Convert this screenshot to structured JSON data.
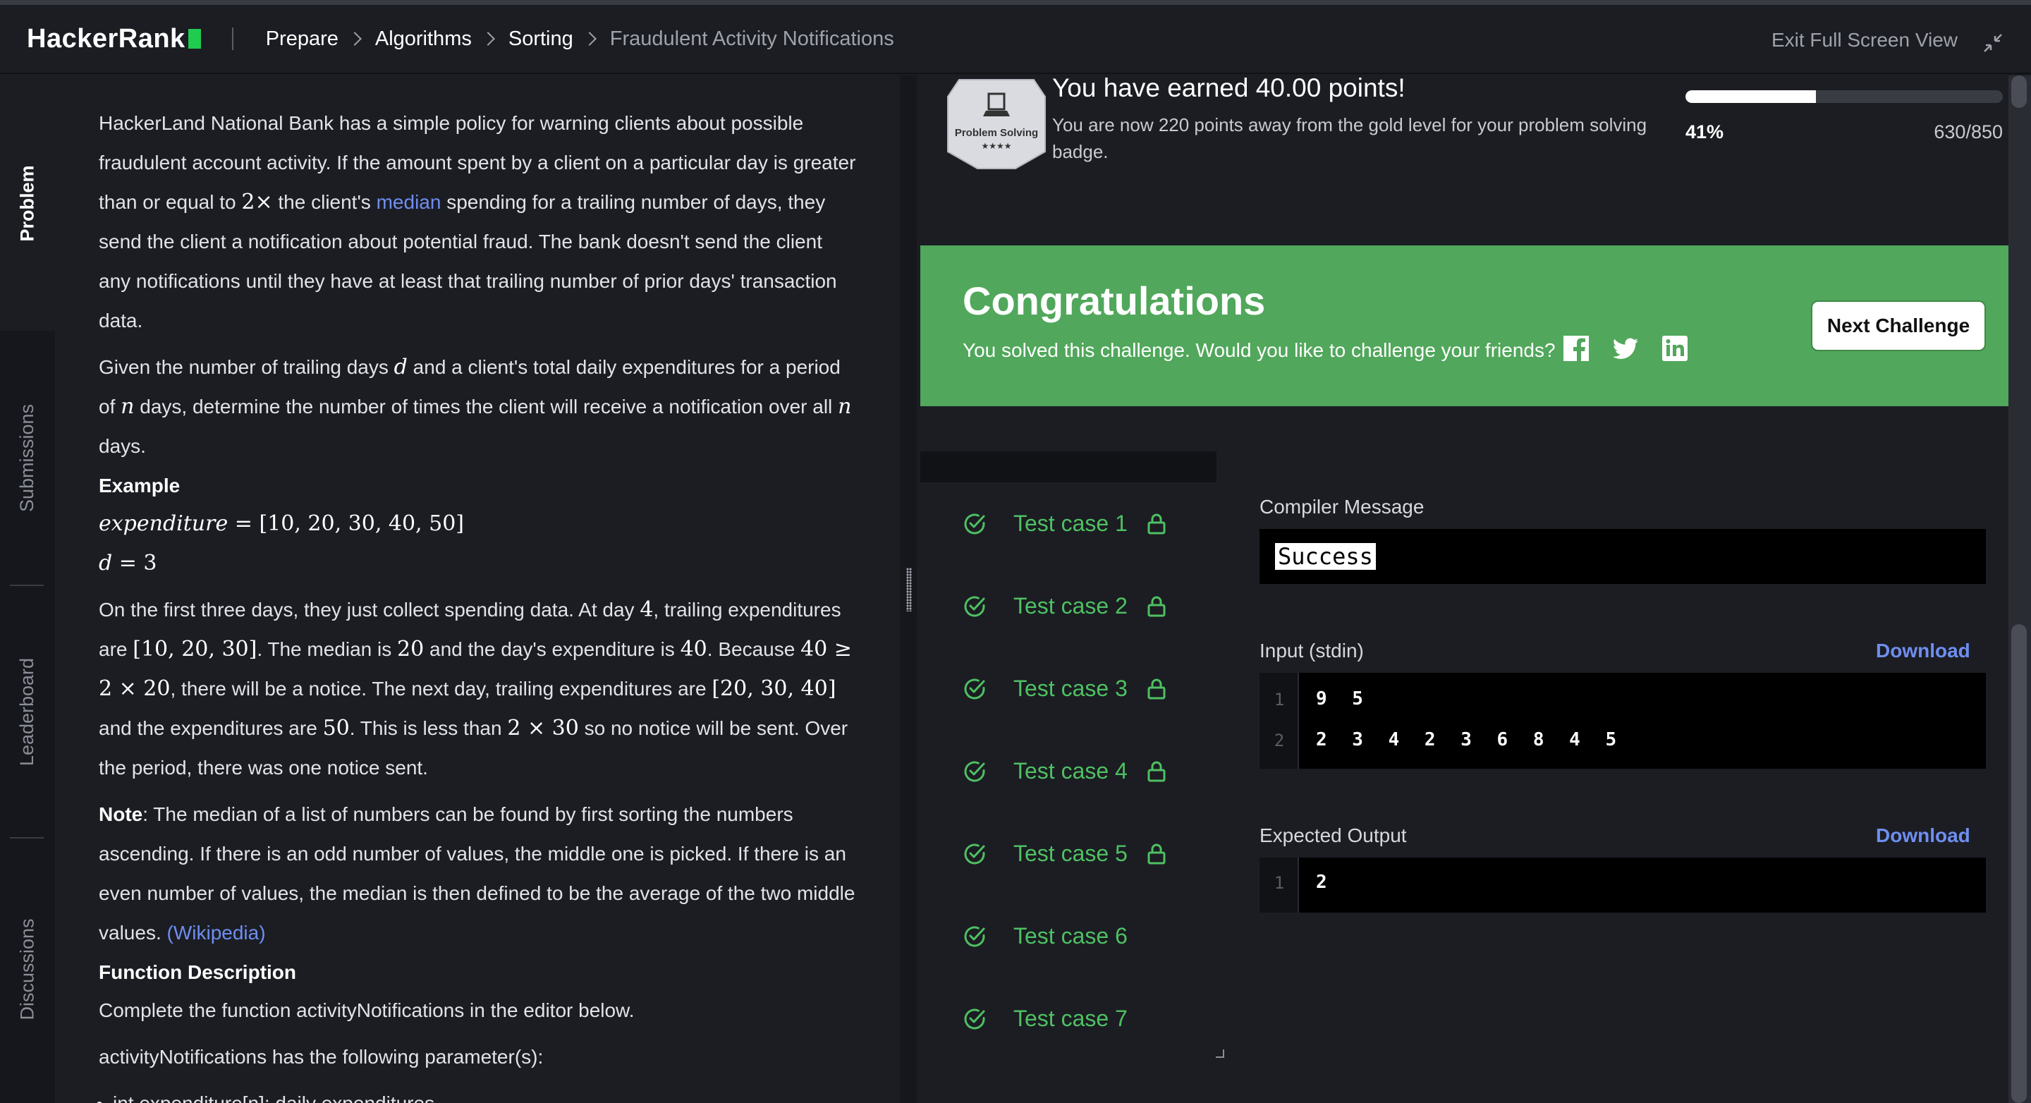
{
  "header": {
    "logo": "HackerRank",
    "breadcrumbs": [
      "Prepare",
      "Algorithms",
      "Sorting",
      "Fraudulent Activity Notifications"
    ],
    "exit_label": "Exit Full Screen View"
  },
  "side_tabs": [
    "Problem",
    "Submissions",
    "Leaderboard",
    "Discussions"
  ],
  "problem": {
    "p1_a": "HackerLand National Bank has a simple policy for warning clients about possible fraudulent account activity. If the amount spent by a client on a particular day is greater than or equal to ",
    "p1_math": "2×",
    "p1_b": " the client's ",
    "p1_link": "median",
    "p1_c": " spending for a trailing number of days, they send the client a notification about potential fraud. The bank doesn't send the client any notifications until they have at least that trailing number of prior days' transaction data.",
    "p2_a": "Given the number of trailing days ",
    "p2_d": "d",
    "p2_b": " and a client's total daily expenditures for a period of ",
    "p2_n1": "n",
    "p2_c": " days, determine the number of times the client will receive a notification over all ",
    "p2_n2": "n",
    "p2_d2": " days.",
    "example_heading": "Example",
    "ex_line1_var": "expenditure",
    "ex_line1_val": " = [10, 20, 30, 40, 50]",
    "ex_line2_var": "d",
    "ex_line2_val": " = 3",
    "p3_a": "On the first three days, they just collect spending data. At day ",
    "p3_m1": "4",
    "p3_b": ", trailing expenditures are ",
    "p3_m2": "[10, 20, 30]",
    "p3_c": ". The median is ",
    "p3_m3": "20",
    "p3_d": " and the day's expenditure is ",
    "p3_m4": "40",
    "p3_e": ". Because ",
    "p3_m5": "40 ≥ 2 × 20",
    "p3_f": ", there will be a notice. The next day, trailing expenditures are ",
    "p3_m6": "[20, 30, 40]",
    "p3_g": " and the expenditures are ",
    "p3_m7": "50",
    "p3_h": ". This is less than ",
    "p3_m8": "2 × 30",
    "p3_i": " so no notice will be sent. Over the period, there was one notice sent.",
    "note_label": "Note",
    "note_text": ": The median of a list of numbers can be found by first sorting the numbers ascending. If there is an odd number of values, the middle one is picked. If there is an even number of values, the median is then defined to be the average of the two middle values. ",
    "note_link": "(Wikipedia)",
    "func_heading": "Function Description",
    "func_p1": "Complete the function activityNotifications in the editor below.",
    "func_p2": "activityNotifications has the following parameter(s):",
    "param1": "int expenditure[n]: daily expenditures"
  },
  "result": {
    "badge_label": "Problem Solving",
    "badge_stars": "★★★★",
    "earned": "You have earned 40.00 points!",
    "away": "You are now 220 points away from the gold level for your problem solving badge.",
    "progress_fraction": 0.41,
    "progress_pct": "41%",
    "progress_points": "630/850",
    "congrats_title": "Congratulations",
    "congrats_sub": "You solved this challenge. Would you like to challenge your friends?",
    "next_button": "Next Challenge"
  },
  "test_cases": [
    {
      "label": "Test case 1",
      "locked": true
    },
    {
      "label": "Test case 2",
      "locked": true
    },
    {
      "label": "Test case 3",
      "locked": true
    },
    {
      "label": "Test case 4",
      "locked": true
    },
    {
      "label": "Test case 5",
      "locked": true
    },
    {
      "label": "Test case 6",
      "locked": false
    },
    {
      "label": "Test case 7",
      "locked": false
    }
  ],
  "output_panel": {
    "compiler_label": "Compiler Message",
    "compiler_message": "Success",
    "input_label": "Input (stdin)",
    "download_label": "Download",
    "input_lines": [
      "9 5",
      "2 3 4 2 3 6 8 4 5"
    ],
    "input_line_numbers": [
      "1",
      "2"
    ],
    "expected_label": "Expected Output",
    "expected_lines": [
      "2"
    ],
    "expected_line_numbers": [
      "1"
    ]
  },
  "colors": {
    "success_green": "#51a75b",
    "test_green": "#4fc062",
    "link_blue": "#6f8ef0",
    "logo_green": "#1fcc4f"
  }
}
